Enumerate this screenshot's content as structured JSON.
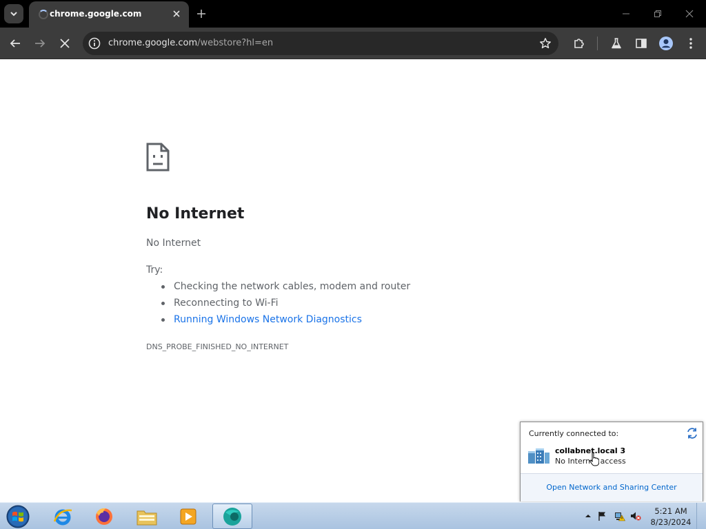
{
  "browser": {
    "tab_title": "chrome.google.com",
    "url_host": "chrome.google.com",
    "url_path": "/webstore?hl=en",
    "colors": {
      "frame": "#000000",
      "toolbar": "#3c3c3c",
      "omnibox": "#282828"
    }
  },
  "icons": {
    "tab_search": "chevron-down-icon",
    "tab_close": "close-icon",
    "new_tab": "plus-icon",
    "back": "arrow-left-icon",
    "forward": "arrow-right-icon",
    "stop": "close-icon",
    "site_info": "info-icon",
    "bookmark": "star-icon",
    "extensions": "puzzle-icon",
    "labs": "flask-icon",
    "side_panel": "side-panel-icon",
    "profile": "profile-icon",
    "menu": "kebab-menu-icon",
    "error": "sad-document-icon"
  },
  "error_page": {
    "heading": "No Internet",
    "subtitle": "No Internet",
    "try_label": "Try:",
    "suggestions": [
      "Checking the network cables, modem and router",
      "Reconnecting to Wi-Fi",
      "Running Windows Network Diagnostics"
    ],
    "error_code": "DNS_PROBE_FINISHED_NO_INTERNET",
    "link_color": "#1a73e8"
  },
  "network_flyout": {
    "title": "Currently connected to:",
    "network_name": "collabnet.local  3",
    "network_status": "No Internet access",
    "footer_link": "Open Network and Sharing Center"
  },
  "taskbar": {
    "apps": [
      "Internet Explorer",
      "Firefox",
      "Windows Explorer",
      "Windows Media Player",
      "Chrome"
    ],
    "clock_time": "5:21 AM",
    "clock_date": "8/23/2024"
  }
}
